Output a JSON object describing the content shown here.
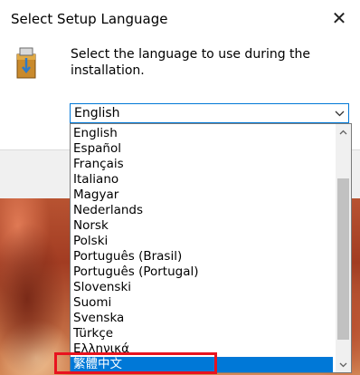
{
  "window": {
    "title": "Select Setup Language",
    "close_glyph": "✕"
  },
  "message": "Select the language to use during the installation.",
  "combo": {
    "selected_value": "English",
    "chevron_icon": "chevron-down-icon"
  },
  "dropdown": {
    "items": [
      "English",
      "Español",
      "Français",
      "Italiano",
      "Magyar",
      "Nederlands",
      "Norsk",
      "Polski",
      "Português (Brasil)",
      "Português (Portugal)",
      "Slovenski",
      "Suomi",
      "Svenska",
      "Türkçe",
      "Ελληνικά",
      "繁體中文"
    ],
    "highlighted_item": "繁體中文"
  },
  "colors": {
    "selection": "#0078d7",
    "annotation_box": "#e8131f",
    "focus_border": "#0078d7"
  }
}
